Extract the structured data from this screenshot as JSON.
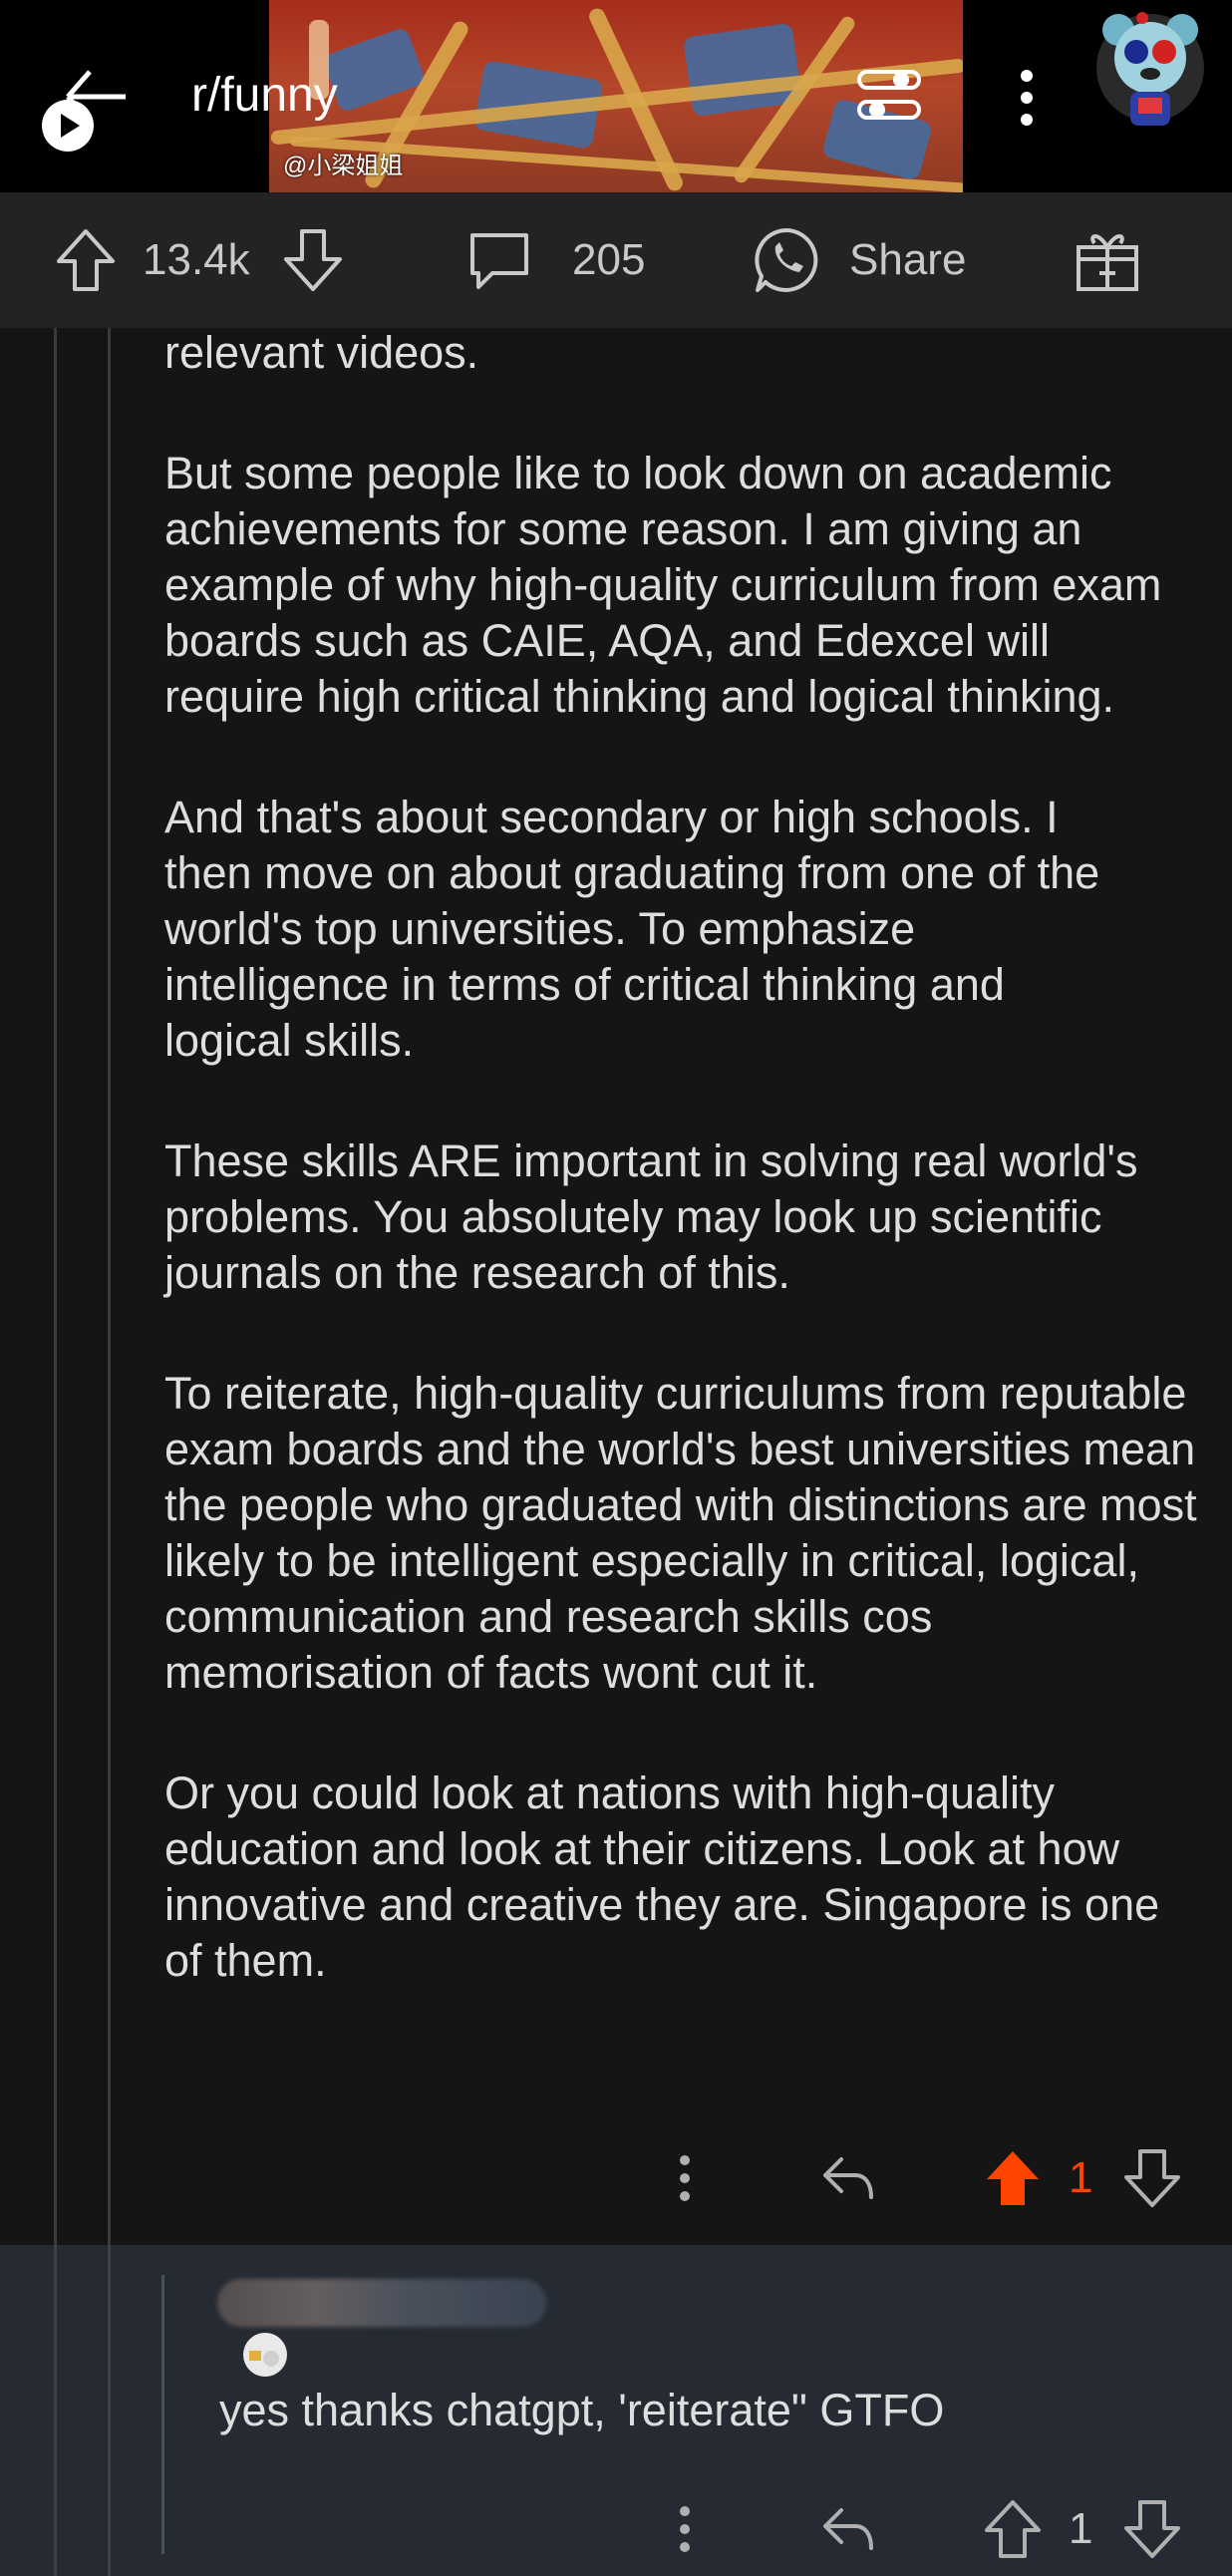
{
  "header": {
    "subreddit": "r/funny",
    "video_watermark": "@小梁姐姐",
    "icons": [
      "back-arrow-icon",
      "filter-icon",
      "more-options-icon",
      "user-avatar"
    ]
  },
  "action_bar": {
    "upvotes": "13.4k",
    "comments": "205",
    "share_label": "Share",
    "icons": [
      "upvote-icon",
      "downvote-icon",
      "comment-icon",
      "share-icon",
      "award-icon"
    ]
  },
  "comment": {
    "paragraphs": [
      "relevant videos.",
      "But some people like to look down on academic achievements for some reason. I am giving an example of why high-quality curriculum from exam boards such as CAIE, AQA, and Edexcel will require high critical thinking and logical thinking.",
      "And that's about secondary or high schools. I then move on about graduating from one of the world's top universities. To emphasize intelligence in terms of critical thinking and logical skills.",
      "These skills ARE important in solving real world's problems. You absolutely may look up scientific journals on the research of this.",
      "To reiterate, high-quality curriculums from reputable exam boards and the world's best universities mean the people who graduated with distinctions are most likely to be intelligent especially in critical, logical, communication and research skills cos memorisation of facts wont cut it.",
      "Or you could look at nations with high-quality education and look at their citizens. Look at how innovative and creative they are. Singapore is one of them."
    ],
    "vote_count": "1",
    "upvoted": true,
    "upvote_color": "#ff4500"
  },
  "reply": {
    "text": "yes thanks chatgpt, 'reiterate\" GTFO",
    "vote_count": "1"
  }
}
